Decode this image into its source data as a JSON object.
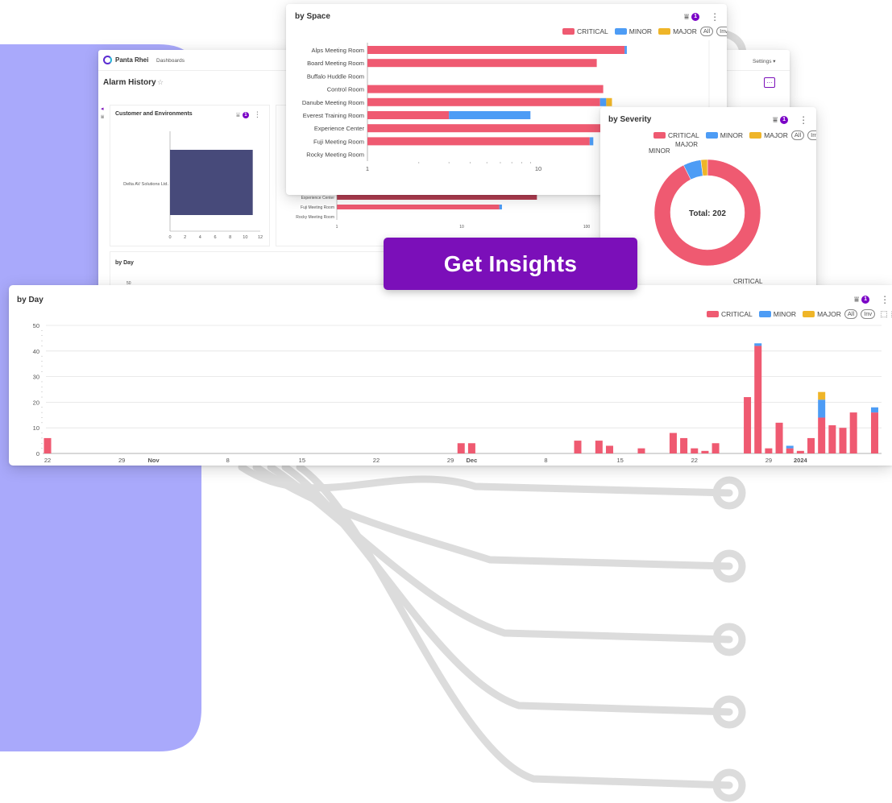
{
  "app": {
    "brand": "Panta Rhei",
    "nav_dashboards": "Dashboards",
    "settings_menu": "Settings ▾",
    "page_title": "Alarm History",
    "star_icon": "☆",
    "more_button": "···"
  },
  "colors": {
    "critical": "#ef5a71",
    "minor": "#4d9cf5",
    "major": "#efb528",
    "accent": "#7b0fb9",
    "bg_panel": "#a9a9fb",
    "decor": "#dcdcdc",
    "customer_bar": "#474a7a"
  },
  "filter_badge": "1",
  "legend": {
    "critical": "CRITICAL",
    "minor": "MINOR",
    "major": "MAJOR",
    "all": "All",
    "inv": "Inv"
  },
  "customer_card": {
    "title": "Customer and Environments",
    "category": "Delta AV Solutions Ltd.",
    "x_ticks": [
      "0",
      "2",
      "4",
      "6",
      "8",
      "10",
      "12"
    ],
    "chart_data": {
      "type": "bar",
      "orientation": "horizontal",
      "categories": [
        "Delta AV Solutions Ltd."
      ],
      "values": [
        11
      ],
      "xlim": [
        0,
        12
      ]
    }
  },
  "by_space": {
    "title": "by Space",
    "x_ticks": [
      "1",
      "10"
    ],
    "chart_data": {
      "type": "bar",
      "orientation": "horizontal",
      "stacked": true,
      "x_scale": "log",
      "categories": [
        "Alps Meeting Room",
        "Board Meeting Room",
        "Buffalo Huddle Room",
        "Control Room",
        "Danube Meeting Room",
        "Everest Training Room",
        "Experience Center",
        "Fuji Meeting Room",
        "Rocky Meeting Room"
      ],
      "series": [
        {
          "name": "CRITICAL",
          "values": [
            32,
            22,
            0,
            24,
            23,
            3,
            40,
            20,
            0
          ]
        },
        {
          "name": "MINOR",
          "values": [
            1,
            0,
            0,
            0,
            2,
            6,
            0,
            1,
            0
          ]
        },
        {
          "name": "MAJOR",
          "values": [
            0,
            0,
            0,
            0,
            2,
            0,
            0,
            0,
            0
          ]
        }
      ]
    }
  },
  "bg_space_fragment": {
    "labels": [
      "Experience Center",
      "Fuji Meeting Room",
      "Rocky Meeting Room"
    ],
    "x_ticks": [
      "1",
      "10",
      "100"
    ]
  },
  "by_severity": {
    "title": "by Severity",
    "center_text": "Total: 202",
    "labels": {
      "minor": "MINOR",
      "major": "MAJOR",
      "critical": "CRITICAL"
    },
    "chart_data": {
      "type": "pie",
      "donut": true,
      "categories": [
        "CRITICAL",
        "MINOR",
        "MAJOR"
      ],
      "values": [
        187,
        11,
        4
      ]
    }
  },
  "bg_by_day": {
    "title": "by Day",
    "y_tick_top": "50"
  },
  "by_day": {
    "title": "by Day",
    "y_ticks": [
      "0",
      "10",
      "20",
      "30",
      "40",
      "50"
    ],
    "x_labels": [
      {
        "text": "22",
        "bold": false,
        "day": 0
      },
      {
        "text": "29",
        "bold": false,
        "day": 7
      },
      {
        "text": "Nov",
        "bold": true,
        "day": 10
      },
      {
        "text": "8",
        "bold": false,
        "day": 17
      },
      {
        "text": "15",
        "bold": false,
        "day": 24
      },
      {
        "text": "22",
        "bold": false,
        "day": 31
      },
      {
        "text": "29",
        "bold": false,
        "day": 38
      },
      {
        "text": "Dec",
        "bold": true,
        "day": 40
      },
      {
        "text": "8",
        "bold": false,
        "day": 47
      },
      {
        "text": "15",
        "bold": false,
        "day": 54
      },
      {
        "text": "22",
        "bold": false,
        "day": 61
      },
      {
        "text": "29",
        "bold": false,
        "day": 68
      },
      {
        "text": "2024",
        "bold": true,
        "day": 71
      }
    ],
    "chart_data": {
      "type": "bar",
      "stacked": true,
      "ylim": [
        0,
        50
      ],
      "x": [
        "Oct 22",
        "Nov 30",
        "Dec 1",
        "Dec 11",
        "Dec 13",
        "Dec 14",
        "Dec 17",
        "Dec 20",
        "Dec 21",
        "Dec 22",
        "Dec 23",
        "Dec 24",
        "Dec 27",
        "Dec 28",
        "Dec 29",
        "Dec 30",
        "Dec 31",
        "Jan 1",
        "Jan 2",
        "Jan 3",
        "Jan 4",
        "Jan 5",
        "Jan 6",
        "Jan 8"
      ],
      "series": [
        {
          "name": "CRITICAL",
          "values": [
            6,
            4,
            4,
            5,
            5,
            3,
            2,
            8,
            6,
            2,
            1,
            4,
            22,
            42,
            2,
            12,
            2,
            1,
            6,
            14,
            11,
            10,
            16,
            16
          ]
        },
        {
          "name": "MINOR",
          "values": [
            0,
            0,
            0,
            0,
            0,
            0,
            0,
            0,
            0,
            0,
            0,
            0,
            0,
            1,
            0,
            0,
            1,
            0,
            0,
            7,
            0,
            0,
            0,
            2
          ]
        },
        {
          "name": "MAJOR",
          "values": [
            0,
            0,
            0,
            0,
            0,
            0,
            0,
            0,
            0,
            0,
            0,
            0,
            0,
            0,
            0,
            0,
            0,
            0,
            0,
            3,
            0,
            0,
            0,
            0
          ]
        }
      ]
    }
  },
  "cta": {
    "label": "Get Insights"
  }
}
